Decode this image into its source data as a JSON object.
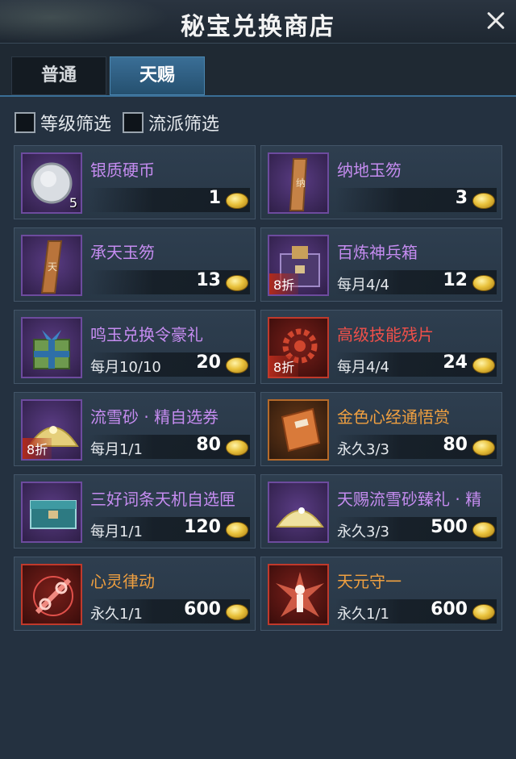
{
  "window": {
    "title": "秘宝兑换商店"
  },
  "tabs": [
    {
      "label": "普通",
      "active": false
    },
    {
      "label": "天赐",
      "active": true
    }
  ],
  "filters": [
    {
      "label": "等级筛选",
      "checked": false
    },
    {
      "label": "流派筛选",
      "checked": false
    }
  ],
  "currency_icon": "gold-ingot-icon",
  "items": [
    {
      "name": "银质硬币",
      "count": "5",
      "discount": "",
      "limit": "",
      "price": "1",
      "quality": "purple",
      "icon": "silver-coin-icon"
    },
    {
      "name": "纳地玉笏",
      "count": "",
      "discount": "",
      "limit": "",
      "price": "3",
      "quality": "purple",
      "icon": "jade-tablet-icon"
    },
    {
      "name": "承天玉笏",
      "count": "",
      "discount": "",
      "limit": "",
      "price": "13",
      "quality": "purple",
      "icon": "jade-tablet-icon"
    },
    {
      "name": "百炼神兵箱",
      "count": "",
      "discount": "8折",
      "limit": "每月4/4",
      "price": "12",
      "quality": "purple",
      "icon": "weapon-chest-icon"
    },
    {
      "name": "鸣玉兑换令豪礼",
      "count": "",
      "discount": "",
      "limit": "每月10/10",
      "price": "20",
      "quality": "purple",
      "icon": "gift-box-icon"
    },
    {
      "name": "高级技能残片",
      "count": "",
      "discount": "8折",
      "limit": "每月4/4",
      "price": "24",
      "quality": "red",
      "icon": "gear-fragment-icon"
    },
    {
      "name": "流雪砂 · 精自选券",
      "count": "",
      "discount": "8折",
      "limit": "每月1/1",
      "price": "80",
      "quality": "purple",
      "icon": "gold-sand-icon"
    },
    {
      "name": "金色心经通悟赏",
      "count": "",
      "discount": "",
      "limit": "永久3/3",
      "price": "80",
      "quality": "orange",
      "icon": "scroll-book-icon"
    },
    {
      "name": "三好词条天机自选匣",
      "count": "",
      "discount": "",
      "limit": "每月1/1",
      "price": "120",
      "quality": "purple",
      "icon": "treasure-casket-icon"
    },
    {
      "name": "天赐流雪砂臻礼 · 精",
      "count": "",
      "discount": "",
      "limit": "永久3/3",
      "price": "500",
      "quality": "purple",
      "icon": "gold-sand-icon"
    },
    {
      "name": "心灵律动",
      "count": "",
      "discount": "",
      "limit": "永久1/1",
      "price": "600",
      "quality": "orange",
      "icon": "chain-emblem-icon"
    },
    {
      "name": "天元守一",
      "count": "",
      "discount": "",
      "limit": "永久1/1",
      "price": "600",
      "quality": "orange",
      "icon": "radiant-figure-icon"
    }
  ],
  "colors": {
    "purple_quality": "#c58cf0",
    "orange_quality": "#f0a040",
    "red_quality": "#f0504a",
    "active_tab": "#3a6e96"
  }
}
